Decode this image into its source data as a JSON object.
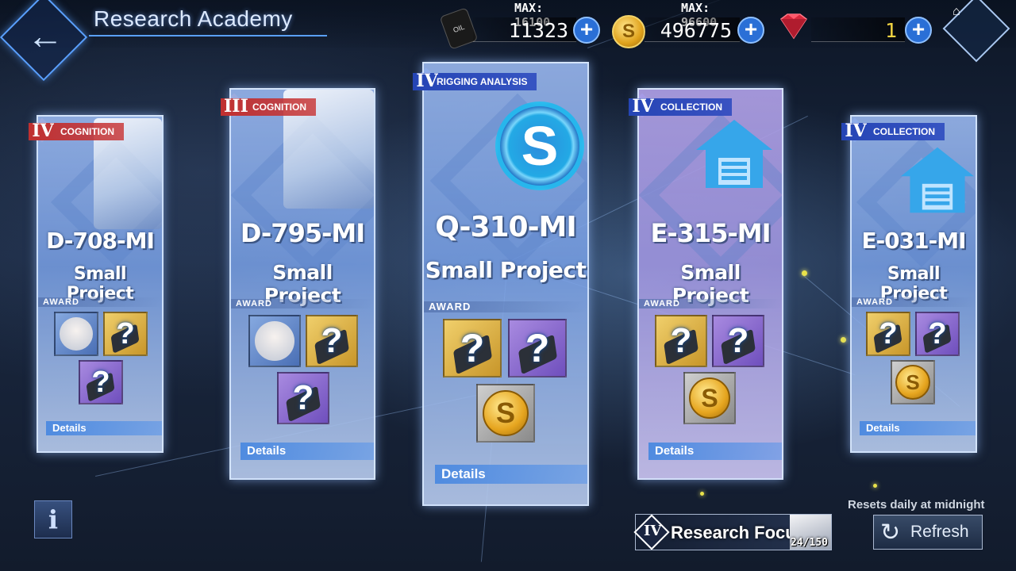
{
  "header": {
    "title": "Research Academy",
    "resources": [
      {
        "name": "oil",
        "icon": "oil-barrel-icon",
        "max_label": "MAX: 16100",
        "value": "11323"
      },
      {
        "name": "coins",
        "icon": "gold-coin-icon",
        "max_label": "MAX: 96600",
        "value": "496775"
      },
      {
        "name": "gems",
        "icon": "red-gem-icon",
        "value": "1"
      }
    ],
    "oil_icon_text": "OIL"
  },
  "cards": [
    {
      "tier": "IV",
      "tag": "COGNITION",
      "tag_color": "#c03030",
      "code": "D-708-MI",
      "subtitle": "Small Project",
      "award_label": "AWARD",
      "details_label": "Details",
      "rewards": [
        "cognitive-chip-icon",
        "mystery-blueprint-icon",
        "mystery-blueprint-icon"
      ]
    },
    {
      "tier": "III",
      "tag": "COGNITION",
      "tag_color": "#c03030",
      "code": "D-795-MI",
      "subtitle": "Small Project",
      "award_label": "AWARD",
      "details_label": "Details",
      "rewards": [
        "cognitive-chip-icon",
        "mystery-blueprint-icon",
        "mystery-blueprint-icon"
      ]
    },
    {
      "tier": "IV",
      "tag": "RIGGING ANALYSIS",
      "tag_color": "#2545b5",
      "code": "Q-310-MI",
      "subtitle": "Small Project",
      "award_label": "AWARD",
      "details_label": "Details",
      "rewards": [
        "mystery-blueprint-icon",
        "mystery-blueprint-icon",
        "gold-coin-icon"
      ]
    },
    {
      "tier": "IV",
      "tag": "COLLECTION",
      "tag_color": "#2545b5",
      "code": "E-315-MI",
      "subtitle": "Small Project",
      "award_label": "AWARD",
      "details_label": "Details",
      "rewards": [
        "mystery-blueprint-icon",
        "mystery-blueprint-icon",
        "gold-coin-icon"
      ]
    },
    {
      "tier": "IV",
      "tag": "COLLECTION",
      "tag_color": "#2545b5",
      "code": "E-031-MI",
      "subtitle": "Small Project",
      "award_label": "AWARD",
      "details_label": "Details",
      "rewards": [
        "mystery-blueprint-icon",
        "mystery-blueprint-icon",
        "gold-coin-icon"
      ]
    }
  ],
  "footer": {
    "info_label": "i",
    "focus": {
      "tier": "IV",
      "label": "Research Focus",
      "count": "24/150"
    },
    "resets_text": "Resets daily at midnight",
    "refresh_label": "Refresh"
  },
  "glyphs": {
    "question": "?",
    "coin": "S",
    "back_arrow": "←",
    "home": "⌂",
    "refresh": "↻"
  }
}
